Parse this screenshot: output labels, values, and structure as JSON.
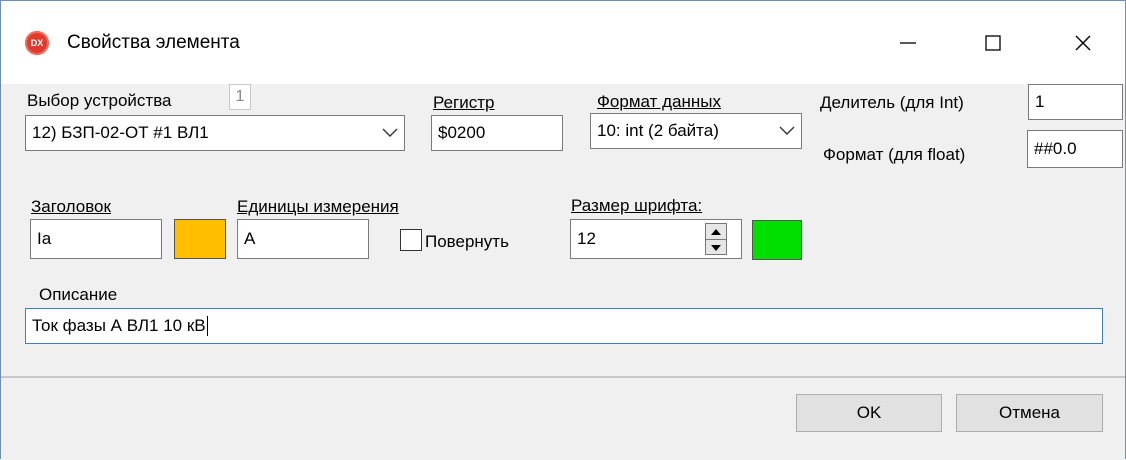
{
  "window": {
    "title": "Свойства элемента",
    "icon": "dx-app-icon"
  },
  "titlebar": {
    "minimize": "—",
    "maximize": "☐",
    "close": "✕"
  },
  "device": {
    "label": "Выбор устройства",
    "index": "1",
    "selected": "12) БЗП-02-ОТ #1 ВЛ1"
  },
  "register": {
    "label": "Регистр",
    "value": "$0200"
  },
  "data_format": {
    "label": "Формат данных",
    "selected": "10: int (2 байта)"
  },
  "divider": {
    "label": "Делитель (для Int)",
    "value": "1"
  },
  "float_format": {
    "label": "Формат (для float)",
    "value": "##0.0"
  },
  "caption": {
    "label": "Заголовок",
    "value": "Ia",
    "color": "#ffbf00"
  },
  "units": {
    "label": "Единицы измерения",
    "value": "А"
  },
  "rotate": {
    "label": "Повернуть",
    "checked": false
  },
  "font_size": {
    "label": "Размер шрифта:",
    "value": "12",
    "color": "#00e000"
  },
  "description": {
    "label": "Описание",
    "value": "Ток фазы А ВЛ1 10 кВ"
  },
  "buttons": {
    "ok": "OK",
    "cancel": "Отмена"
  }
}
